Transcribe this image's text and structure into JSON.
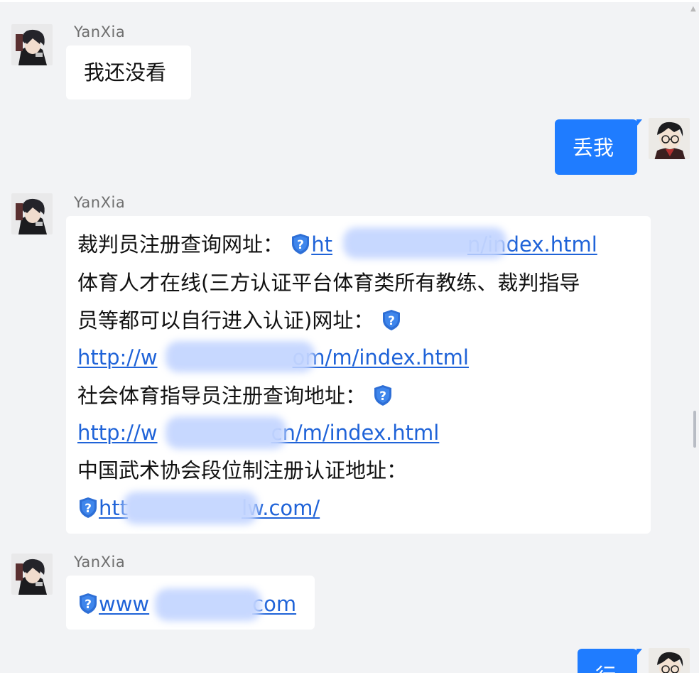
{
  "messages": [
    {
      "sender": "YanXia",
      "text": "我还没看"
    },
    {
      "text": "丢我"
    },
    {
      "sender": "YanXia",
      "lines": [
        {
          "text": "裁判员注册查询网址：",
          "link": "ht… n/index.html"
        },
        {
          "text": "体育人才在线(三方认证平台体育类所有教练、裁判指导"
        },
        {
          "text": "员等都可以自行进入认证)网址："
        },
        {
          "link": "http://ww… om/m/index.html"
        },
        {
          "text": "社会体育指导员注册查询地址："
        },
        {
          "link": "http://ww… cn/m/index.html"
        },
        {
          "text": "中国武术协会段位制注册认证地址："
        },
        {
          "link": "htt… lw.com/"
        }
      ]
    },
    {
      "sender": "YanXia",
      "link": "www… com"
    },
    {
      "text": "行"
    }
  ],
  "link_parts": {
    "l1_prefix": "ht",
    "l1_suffix": "n/index.html",
    "l2_prefix": "http://w",
    "l2_suffix": "om/m/index.html",
    "l3_prefix": "http://w",
    "l3_suffix": "cn/m/index.html",
    "l4_prefix": "htt",
    "l4_suffix": "lw.com/",
    "l5_prefix": "www",
    "l5_suffix": "com"
  },
  "colors": {
    "background": "#f2f3f5",
    "incoming_bubble": "#ffffff",
    "outgoing_bubble": "#1f7cff",
    "link": "#1f63d8",
    "security_icon": "#2e6fd6"
  },
  "icons": [
    "security-shield-icon",
    "scroll-up-icon"
  ]
}
